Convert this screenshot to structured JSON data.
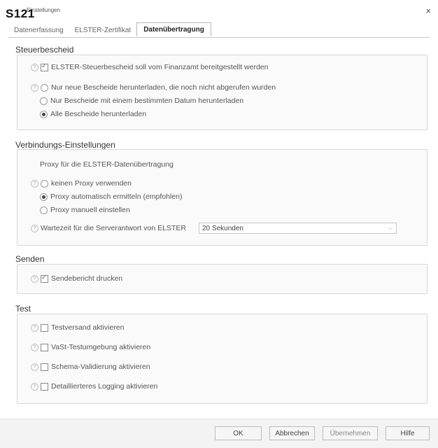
{
  "window": {
    "label": "S121",
    "title": "Einstellungen",
    "close_glyph": "×"
  },
  "tabs": [
    {
      "label": "Datenerfassung",
      "active": false
    },
    {
      "label": "ELSTER-Zertifikat",
      "active": false
    },
    {
      "label": "Datenübertragung",
      "active": true
    }
  ],
  "steuerbescheid": {
    "title": "Steuerbescheid",
    "checkbox_label": "ELSTER-Steuerbescheid soll vom Finanzamt bereitgestellt werden",
    "checkbox_checked": true,
    "radio_options": [
      "Nur neue Bescheide herunterladen, die noch nicht abgerufen wurden",
      "Nur Bescheide mit einem bestimmten Datum herunterladen",
      "Alle Bescheide herunterladen"
    ],
    "radio_selected": 2
  },
  "verbindung": {
    "title": "Verbindungs-Einstellungen",
    "proxy_label": "Proxy für die ELSTER-Datenübertragung",
    "radio_options": [
      "keinen Proxy verwenden",
      "Proxy automatisch ermitteln (empfohlen)",
      "Proxy manuell einstellen"
    ],
    "radio_selected": 1,
    "wait_label": "Wartezeit für die Serverantwort von ELSTER",
    "wait_value": "20 Sekunden"
  },
  "senden": {
    "title": "Senden",
    "checkbox_label": "Sendebericht drucken",
    "checkbox_checked": true
  },
  "test": {
    "title": "Test",
    "checkboxes": [
      "Testversand aktivieren",
      "VaSt-Testumgebung aktivieren",
      "Schema-Validierung aktivieren",
      "Detaillierteres Logging aktivieren"
    ]
  },
  "buttons": {
    "ok": "OK",
    "cancel": "Abbrechen",
    "apply": "Übernehmen",
    "help": "Hilfe"
  },
  "icons": {
    "help": "help-icon",
    "close": "close-icon",
    "dropdown": "chevron-down-icon"
  }
}
